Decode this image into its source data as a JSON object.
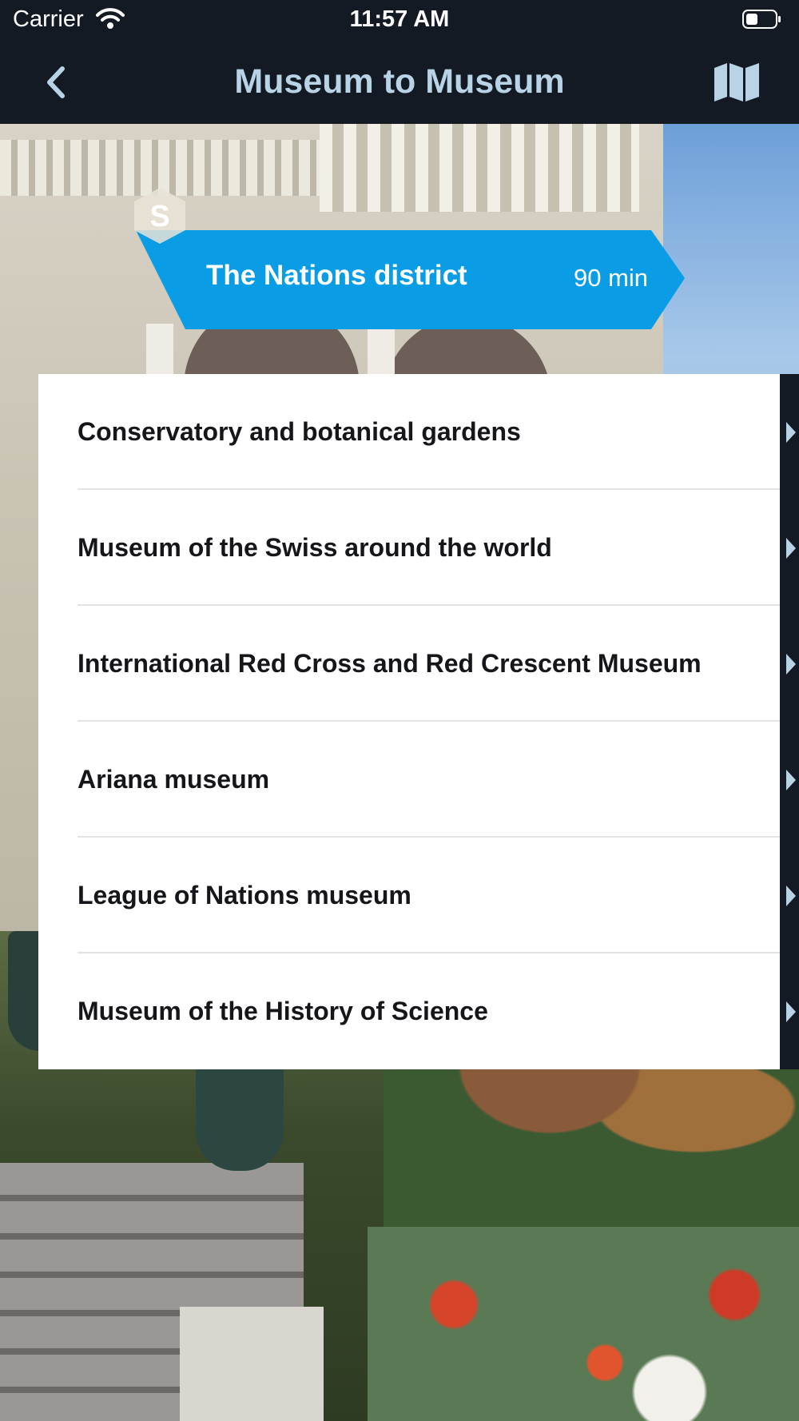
{
  "status_bar": {
    "carrier": "Carrier",
    "time": "11:57 AM"
  },
  "nav": {
    "title": "Museum to Museum",
    "back_icon": "chevron-left-icon",
    "map_icon": "map-icon"
  },
  "banner": {
    "label": "The Nations district",
    "duration": "90 min",
    "badge_letter": "S",
    "color": "#0a9de6"
  },
  "list": {
    "items": [
      {
        "label": "Conservatory and botanical gardens"
      },
      {
        "label": "Museum of the Swiss around the world"
      },
      {
        "label": "International Red Cross and Red Crescent Museum"
      },
      {
        "label": "Ariana museum"
      },
      {
        "label": "League of Nations museum"
      },
      {
        "label": "Museum of the History of Science"
      }
    ]
  },
  "colors": {
    "bar_background": "#131a24",
    "title_color": "#b9d3e6",
    "card_background": "#ffffff"
  }
}
